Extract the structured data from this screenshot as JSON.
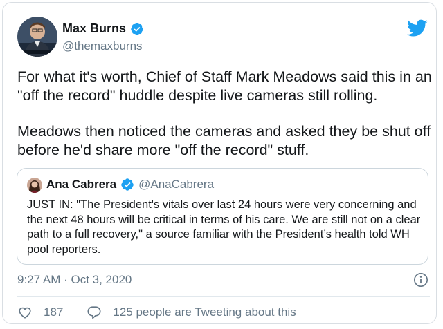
{
  "author": {
    "name": "Max Burns",
    "handle": "@themaxburns"
  },
  "tweet": {
    "paragraphs": [
      "For what it's worth, Chief of Staff Mark Meadows said this in an \"off the record\" huddle despite live cameras still rolling.",
      "Meadows then noticed the cameras and asked they be shut off before he'd share more \"off the record\" stuff."
    ]
  },
  "quoted": {
    "name": "Ana Cabrera",
    "handle": "@AnaCabrera",
    "text": "JUST IN: \"The President's vitals over last 24 hours were very concerning and the next 48 hours will be critical in terms of his care. We are still not on a clear path to a full recovery,\" a source familiar with the President’s health told WH pool reporters."
  },
  "timestamp": "9:27 AM · Oct 3, 2020",
  "actions": {
    "likes": "187",
    "conversation": "125 people are Tweeting about this"
  },
  "icons": {
    "verified": "verified-badge-icon",
    "brand": "twitter-bird-icon",
    "info": "info-icon",
    "like": "heart-icon",
    "reply": "speech-bubble-icon"
  },
  "colors": {
    "brand_blue": "#1da1f2",
    "text": "#14171a",
    "muted": "#657786",
    "border": "#ccd6dd"
  }
}
